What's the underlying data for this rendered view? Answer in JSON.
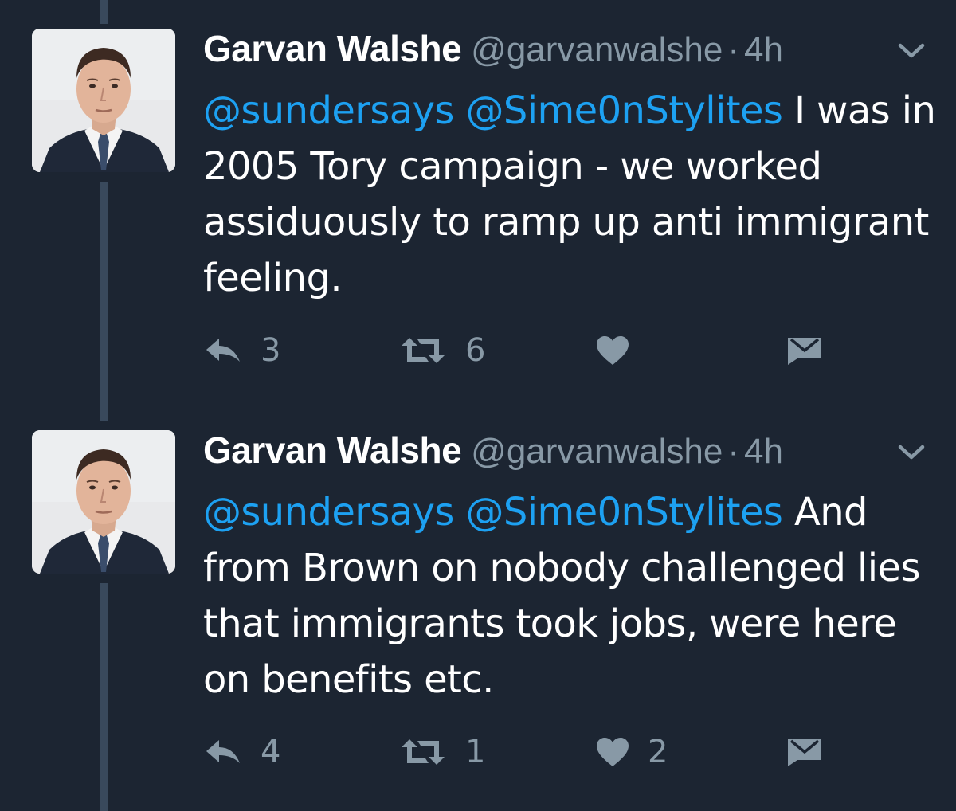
{
  "colors": {
    "background": "#1c2532",
    "thread_line": "#39495c",
    "name": "#ffffff",
    "meta": "#8899a6",
    "mention": "#1da1f2",
    "icon": "#8899a6"
  },
  "tweets": [
    {
      "author": {
        "name": "Garvan Walshe",
        "handle": "@garvanwalshe",
        "avatar_icon": "profile-photo-man-in-suit"
      },
      "separator": "·",
      "time": "4h",
      "mentions": [
        "@sundersays",
        "@Sime0nStylites"
      ],
      "text": "I was in 2005 Tory campaign - we worked assiduously to ramp up anti immigrant feeling.",
      "actions": {
        "reply_icon": "reply-icon",
        "reply_count": "3",
        "retweet_icon": "retweet-icon",
        "retweet_count": "6",
        "like_icon": "heart-icon",
        "like_count": "",
        "dm_icon": "envelope-icon"
      }
    },
    {
      "author": {
        "name": "Garvan Walshe",
        "handle": "@garvanwalshe",
        "avatar_icon": "profile-photo-man-in-suit"
      },
      "separator": "·",
      "time": "4h",
      "mentions": [
        "@sundersays",
        "@Sime0nStylites"
      ],
      "text": "And from Brown on nobody challenged lies that immigrants took jobs, were here on benefits etc.",
      "actions": {
        "reply_icon": "reply-icon",
        "reply_count": "4",
        "retweet_icon": "retweet-icon",
        "retweet_count": "1",
        "like_icon": "heart-icon",
        "like_count": "2",
        "dm_icon": "envelope-icon"
      }
    }
  ]
}
